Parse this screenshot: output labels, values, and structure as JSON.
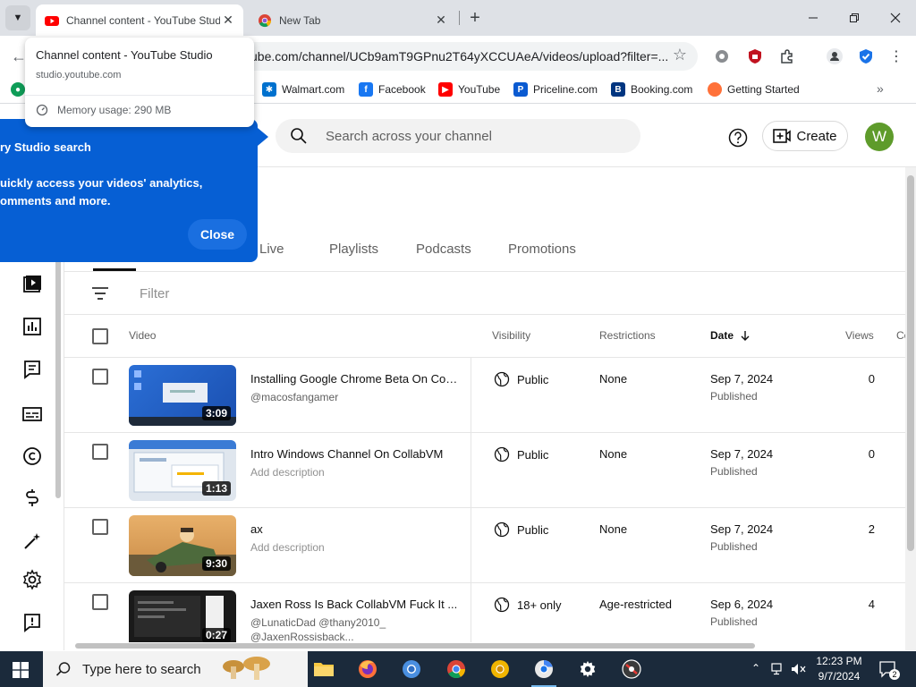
{
  "browser": {
    "tabs": [
      {
        "title": "Channel content - YouTube Studio",
        "active": true
      },
      {
        "title": "New Tab",
        "active": false
      }
    ],
    "url": "ube.com/channel/UCb9amT9GPnu2T64yXCCUAeA/videos/upload?filter=...",
    "hover_card": {
      "title": "Channel content - YouTube Studio",
      "domain": "studio.youtube.com",
      "memory": "Memory usage: 290 MB"
    },
    "bookmarks": [
      "Walmart.com",
      "Facebook",
      "YouTube",
      "Priceline.com",
      "Booking.com",
      "Getting Started"
    ]
  },
  "studio": {
    "search_placeholder": "Search across your channel",
    "create_label": "Create",
    "avatar_letter": "W",
    "callout": {
      "title": "ry Studio search",
      "body": "uickly access your videos' analytics, omments and more.",
      "close_label": "Close"
    },
    "content_tabs": [
      "Live",
      "Playlists",
      "Podcasts",
      "Promotions"
    ],
    "filter_placeholder": "Filter",
    "columns": {
      "video": "Video",
      "visibility": "Visibility",
      "restrictions": "Restrictions",
      "date": "Date",
      "views": "Views",
      "comments": "Co"
    },
    "videos": [
      {
        "title": "Installing Google Chrome Beta On Coll...",
        "desc": "@macosfangamer",
        "duration": "3:09",
        "visibility": "Public",
        "restrictions": "None",
        "date": "Sep 7, 2024",
        "status": "Published",
        "views": "0"
      },
      {
        "title": "Intro Windows Channel On CollabVM",
        "desc": "Add description",
        "duration": "1:13",
        "visibility": "Public",
        "restrictions": "None",
        "date": "Sep 7, 2024",
        "status": "Published",
        "views": "0"
      },
      {
        "title": "ax",
        "desc": "Add description",
        "duration": "9:30",
        "visibility": "Public",
        "restrictions": "None",
        "date": "Sep 7, 2024",
        "status": "Published",
        "views": "2"
      },
      {
        "title": "Jaxen Ross Is Back CollabVM Fuck It ...",
        "desc": "@LunaticDad @thany2010_ @JaxenRossisback...",
        "duration": "0:27",
        "visibility": "18+ only",
        "restrictions": "Age-restricted",
        "date": "Sep 6, 2024",
        "status": "Published",
        "views": "4"
      }
    ]
  },
  "taskbar": {
    "search_placeholder": "Type here to search",
    "time": "12:23 PM",
    "date": "9/7/2024",
    "notifications": "2"
  },
  "colors": {
    "callout_blue": "#065fd4",
    "avatar_green": "#5e9b2b",
    "youtube_red": "#ff0000",
    "taskbar": "#1b2a3b"
  }
}
